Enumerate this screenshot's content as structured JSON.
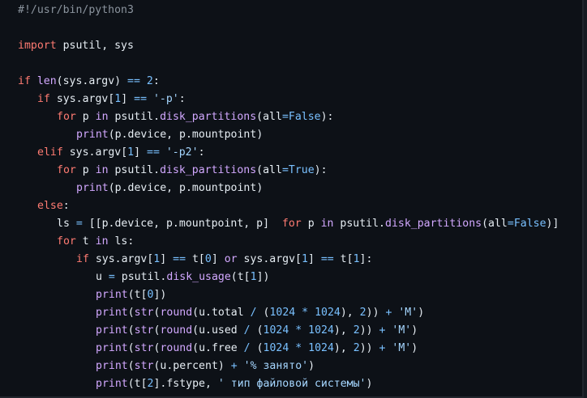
{
  "code": {
    "language": "python",
    "lines": [
      {
        "indent": 0,
        "tokens": [
          {
            "t": "comment",
            "v": "#!/usr/bin/python3"
          }
        ]
      },
      {
        "indent": 0,
        "tokens": []
      },
      {
        "indent": 0,
        "tokens": [
          {
            "t": "kw",
            "v": "import"
          },
          {
            "t": "plain",
            "v": " psutil, sys"
          }
        ]
      },
      {
        "indent": 0,
        "tokens": []
      },
      {
        "indent": 0,
        "tokens": [
          {
            "t": "kw",
            "v": "if"
          },
          {
            "t": "plain",
            "v": " "
          },
          {
            "t": "builtin",
            "v": "len"
          },
          {
            "t": "plain",
            "v": "(sys.argv) "
          },
          {
            "t": "op",
            "v": "=="
          },
          {
            "t": "plain",
            "v": " "
          },
          {
            "t": "num",
            "v": "2"
          },
          {
            "t": "plain",
            "v": ":"
          }
        ]
      },
      {
        "indent": 1,
        "tokens": [
          {
            "t": "kw",
            "v": "if"
          },
          {
            "t": "plain",
            "v": " sys.argv["
          },
          {
            "t": "num",
            "v": "1"
          },
          {
            "t": "plain",
            "v": "] "
          },
          {
            "t": "op",
            "v": "=="
          },
          {
            "t": "plain",
            "v": " "
          },
          {
            "t": "str",
            "v": "'-p'"
          },
          {
            "t": "plain",
            "v": ":"
          }
        ]
      },
      {
        "indent": 2,
        "tokens": [
          {
            "t": "kw",
            "v": "for"
          },
          {
            "t": "plain",
            "v": " p "
          },
          {
            "t": "kw2",
            "v": "in"
          },
          {
            "t": "plain",
            "v": " psutil."
          },
          {
            "t": "fn",
            "v": "disk_partitions"
          },
          {
            "t": "plain",
            "v": "(all"
          },
          {
            "t": "op",
            "v": "="
          },
          {
            "t": "const",
            "v": "False"
          },
          {
            "t": "plain",
            "v": "):"
          }
        ]
      },
      {
        "indent": 3,
        "tokens": [
          {
            "t": "builtin",
            "v": "print"
          },
          {
            "t": "plain",
            "v": "(p.device, p.mountpoint)"
          }
        ]
      },
      {
        "indent": 1,
        "tokens": [
          {
            "t": "kw",
            "v": "elif"
          },
          {
            "t": "plain",
            "v": " sys.argv["
          },
          {
            "t": "num",
            "v": "1"
          },
          {
            "t": "plain",
            "v": "] "
          },
          {
            "t": "op",
            "v": "=="
          },
          {
            "t": "plain",
            "v": " "
          },
          {
            "t": "str",
            "v": "'-p2'"
          },
          {
            "t": "plain",
            "v": ":"
          }
        ]
      },
      {
        "indent": 2,
        "tokens": [
          {
            "t": "kw",
            "v": "for"
          },
          {
            "t": "plain",
            "v": " p "
          },
          {
            "t": "kw2",
            "v": "in"
          },
          {
            "t": "plain",
            "v": " psutil."
          },
          {
            "t": "fn",
            "v": "disk_partitions"
          },
          {
            "t": "plain",
            "v": "(all"
          },
          {
            "t": "op",
            "v": "="
          },
          {
            "t": "const",
            "v": "True"
          },
          {
            "t": "plain",
            "v": "):"
          }
        ]
      },
      {
        "indent": 3,
        "tokens": [
          {
            "t": "builtin",
            "v": "print"
          },
          {
            "t": "plain",
            "v": "(p.device, p.mountpoint)"
          }
        ]
      },
      {
        "indent": 1,
        "tokens": [
          {
            "t": "kw",
            "v": "else"
          },
          {
            "t": "plain",
            "v": ":"
          }
        ]
      },
      {
        "indent": 2,
        "tokens": [
          {
            "t": "plain",
            "v": "ls "
          },
          {
            "t": "op",
            "v": "="
          },
          {
            "t": "plain",
            "v": " [[p.device, p.mountpoint, p]  "
          },
          {
            "t": "kw",
            "v": "for"
          },
          {
            "t": "plain",
            "v": " p "
          },
          {
            "t": "kw2",
            "v": "in"
          },
          {
            "t": "plain",
            "v": " psutil."
          },
          {
            "t": "fn",
            "v": "disk_partitions"
          },
          {
            "t": "plain",
            "v": "(all"
          },
          {
            "t": "op",
            "v": "="
          },
          {
            "t": "const",
            "v": "False"
          },
          {
            "t": "plain",
            "v": ")]"
          }
        ]
      },
      {
        "indent": 2,
        "tokens": [
          {
            "t": "kw",
            "v": "for"
          },
          {
            "t": "plain",
            "v": " t "
          },
          {
            "t": "kw2",
            "v": "in"
          },
          {
            "t": "plain",
            "v": " ls:"
          }
        ]
      },
      {
        "indent": 3,
        "tokens": [
          {
            "t": "kw",
            "v": "if"
          },
          {
            "t": "plain",
            "v": " sys.argv["
          },
          {
            "t": "num",
            "v": "1"
          },
          {
            "t": "plain",
            "v": "] "
          },
          {
            "t": "op",
            "v": "=="
          },
          {
            "t": "plain",
            "v": " t["
          },
          {
            "t": "num",
            "v": "0"
          },
          {
            "t": "plain",
            "v": "] "
          },
          {
            "t": "kw2",
            "v": "or"
          },
          {
            "t": "plain",
            "v": " sys.argv["
          },
          {
            "t": "num",
            "v": "1"
          },
          {
            "t": "plain",
            "v": "] "
          },
          {
            "t": "op",
            "v": "=="
          },
          {
            "t": "plain",
            "v": " t["
          },
          {
            "t": "num",
            "v": "1"
          },
          {
            "t": "plain",
            "v": "]:"
          }
        ]
      },
      {
        "indent": 4,
        "tokens": [
          {
            "t": "plain",
            "v": "u "
          },
          {
            "t": "op",
            "v": "="
          },
          {
            "t": "plain",
            "v": " psutil."
          },
          {
            "t": "fn",
            "v": "disk_usage"
          },
          {
            "t": "plain",
            "v": "(t["
          },
          {
            "t": "num",
            "v": "1"
          },
          {
            "t": "plain",
            "v": "])"
          }
        ]
      },
      {
        "indent": 4,
        "tokens": [
          {
            "t": "builtin",
            "v": "print"
          },
          {
            "t": "plain",
            "v": "(t["
          },
          {
            "t": "num",
            "v": "0"
          },
          {
            "t": "plain",
            "v": "])"
          }
        ]
      },
      {
        "indent": 4,
        "tokens": [
          {
            "t": "builtin",
            "v": "print"
          },
          {
            "t": "plain",
            "v": "("
          },
          {
            "t": "builtin",
            "v": "str"
          },
          {
            "t": "plain",
            "v": "("
          },
          {
            "t": "builtin",
            "v": "round"
          },
          {
            "t": "plain",
            "v": "(u.total "
          },
          {
            "t": "op",
            "v": "/"
          },
          {
            "t": "plain",
            "v": " ("
          },
          {
            "t": "num",
            "v": "1024"
          },
          {
            "t": "plain",
            "v": " "
          },
          {
            "t": "op",
            "v": "*"
          },
          {
            "t": "plain",
            "v": " "
          },
          {
            "t": "num",
            "v": "1024"
          },
          {
            "t": "plain",
            "v": "), "
          },
          {
            "t": "num",
            "v": "2"
          },
          {
            "t": "plain",
            "v": ")) "
          },
          {
            "t": "op",
            "v": "+"
          },
          {
            "t": "plain",
            "v": " "
          },
          {
            "t": "str",
            "v": "'M'"
          },
          {
            "t": "plain",
            "v": ")"
          }
        ]
      },
      {
        "indent": 4,
        "tokens": [
          {
            "t": "builtin",
            "v": "print"
          },
          {
            "t": "plain",
            "v": "("
          },
          {
            "t": "builtin",
            "v": "str"
          },
          {
            "t": "plain",
            "v": "("
          },
          {
            "t": "builtin",
            "v": "round"
          },
          {
            "t": "plain",
            "v": "(u.used "
          },
          {
            "t": "op",
            "v": "/"
          },
          {
            "t": "plain",
            "v": " ("
          },
          {
            "t": "num",
            "v": "1024"
          },
          {
            "t": "plain",
            "v": " "
          },
          {
            "t": "op",
            "v": "*"
          },
          {
            "t": "plain",
            "v": " "
          },
          {
            "t": "num",
            "v": "1024"
          },
          {
            "t": "plain",
            "v": "), "
          },
          {
            "t": "num",
            "v": "2"
          },
          {
            "t": "plain",
            "v": ")) "
          },
          {
            "t": "op",
            "v": "+"
          },
          {
            "t": "plain",
            "v": " "
          },
          {
            "t": "str",
            "v": "'M'"
          },
          {
            "t": "plain",
            "v": ")"
          }
        ]
      },
      {
        "indent": 4,
        "tokens": [
          {
            "t": "builtin",
            "v": "print"
          },
          {
            "t": "plain",
            "v": "("
          },
          {
            "t": "builtin",
            "v": "str"
          },
          {
            "t": "plain",
            "v": "("
          },
          {
            "t": "builtin",
            "v": "round"
          },
          {
            "t": "plain",
            "v": "(u.free "
          },
          {
            "t": "op",
            "v": "/"
          },
          {
            "t": "plain",
            "v": " ("
          },
          {
            "t": "num",
            "v": "1024"
          },
          {
            "t": "plain",
            "v": " "
          },
          {
            "t": "op",
            "v": "*"
          },
          {
            "t": "plain",
            "v": " "
          },
          {
            "t": "num",
            "v": "1024"
          },
          {
            "t": "plain",
            "v": "), "
          },
          {
            "t": "num",
            "v": "2"
          },
          {
            "t": "plain",
            "v": ")) "
          },
          {
            "t": "op",
            "v": "+"
          },
          {
            "t": "plain",
            "v": " "
          },
          {
            "t": "str",
            "v": "'M'"
          },
          {
            "t": "plain",
            "v": ")"
          }
        ]
      },
      {
        "indent": 4,
        "tokens": [
          {
            "t": "builtin",
            "v": "print"
          },
          {
            "t": "plain",
            "v": "("
          },
          {
            "t": "builtin",
            "v": "str"
          },
          {
            "t": "plain",
            "v": "(u.percent) "
          },
          {
            "t": "op",
            "v": "+"
          },
          {
            "t": "plain",
            "v": " "
          },
          {
            "t": "str",
            "v": "'% занято'"
          },
          {
            "t": "plain",
            "v": ")"
          }
        ]
      },
      {
        "indent": 4,
        "tokens": [
          {
            "t": "builtin",
            "v": "print"
          },
          {
            "t": "plain",
            "v": "(t["
          },
          {
            "t": "num",
            "v": "2"
          },
          {
            "t": "plain",
            "v": "].fstype, "
          },
          {
            "t": "str",
            "v": "' тип файловой системы'"
          },
          {
            "t": "plain",
            "v": ")"
          }
        ]
      }
    ]
  },
  "colors": {
    "background": "#0d1117",
    "keyword": "#ff7b72",
    "function": "#d2a8ff",
    "number": "#79c0ff",
    "string": "#a5d6ff",
    "comment": "#8b949e",
    "text": "#e6edf3"
  }
}
